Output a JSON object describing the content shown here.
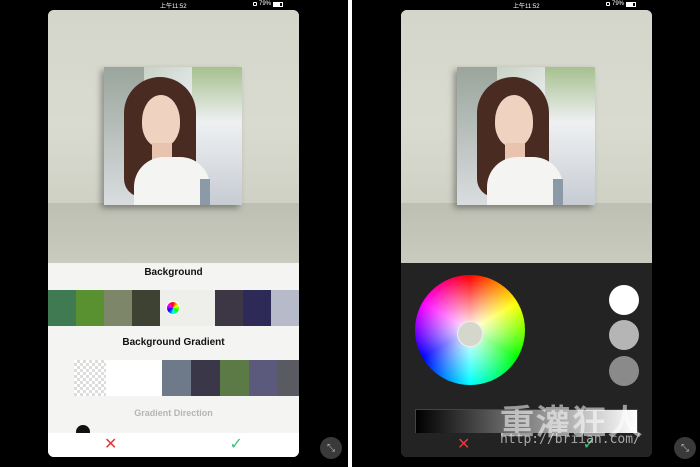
{
  "status_bar": {
    "time": "上午11:52",
    "battery": "79%"
  },
  "left_screen": {
    "background_section": {
      "title": "Background",
      "swatches": [
        "#3f7a52",
        "#5a9130",
        "#7d8668",
        "#3e4232",
        "color-wheel",
        "#eeeeea",
        "#3d3645",
        "#2d2a58",
        "#b7bbc9"
      ]
    },
    "gradient_section": {
      "title": "Background Gradient",
      "swatches": [
        "transparent",
        "#ffffff",
        "#6e7a8a",
        "#3a3848",
        "#5b7a46",
        "#5c5a7c",
        "#5a5a62"
      ]
    },
    "gradient_direction_label": "Gradient Direction",
    "actions": {
      "cancel_icon": "close-icon",
      "confirm_icon": "check-icon"
    }
  },
  "right_screen": {
    "color_wheel": {
      "selected_color": "#d5d6cc"
    },
    "preset_circles": [
      "#ffffff",
      "#b5b5b5",
      "#8a8a8a"
    ],
    "brightness_slider": {
      "from": "#000000",
      "to": "#ffffff"
    },
    "actions": {
      "cancel_icon": "close-icon",
      "confirm_icon": "check-icon"
    }
  },
  "watermark": {
    "text": "重灌狂人",
    "url": "http://briian.com/"
  },
  "colors": {
    "cancel": "#e23b3b",
    "confirm": "#3ec17a"
  }
}
